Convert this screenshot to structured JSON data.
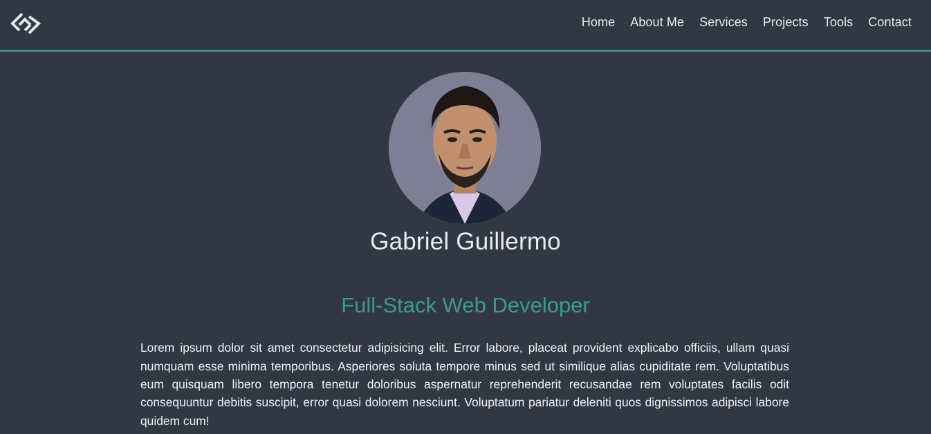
{
  "nav": {
    "logo_icon": "diamond-link-logo",
    "accent_color": "#3d8a7d",
    "items": [
      "Home",
      "About Me",
      "Services",
      "Projects",
      "Tools",
      "Contact"
    ]
  },
  "profile": {
    "name": "Gabriel Guillermo",
    "role": "Full-Stack Web Developer",
    "bio": "Lorem ipsum dolor sit amet consectetur adipisicing elit. Error labore, placeat provident explicabo officiis, ullam quasi numquam esse minima temporibus. Asperiores soluta tempore minus sed ut similique alias cupiditate rem. Voluptatibus eum quisquam libero tempora tenetur doloribus aspernatur reprehenderit recusandae rem voluptates facilis odit consequuntur debitis suscipit, error quasi dolorem nesciunt. Voluptatum pariatur deleniti quos dignissimos adipisci labore quidem cum!",
    "role_color": "#3e9a8a",
    "background_color": "#313844"
  }
}
